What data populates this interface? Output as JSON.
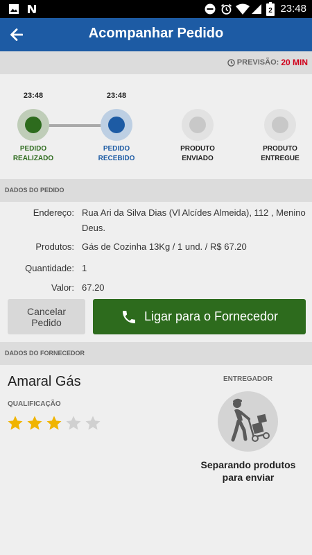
{
  "status_bar": {
    "time": "23:48",
    "battery": "2",
    "left_icons": [
      "image-icon",
      "n-icon"
    ],
    "right_icons": [
      "dnd-icon",
      "alarm-icon",
      "wifi-icon",
      "signal-icon",
      "battery-icon"
    ]
  },
  "app_bar": {
    "title": "Acompanhar Pedido",
    "back_icon": "back-arrow-icon"
  },
  "eta": {
    "label": "PREVISÃO:",
    "value": "20 MIN",
    "icon": "clock-icon"
  },
  "timeline": {
    "steps": [
      {
        "time": "23:48",
        "line1": "PEDIDO",
        "line2": "REALIZADO",
        "state": "done",
        "color": "#2d6b1d",
        "ring": "#bfcdb8"
      },
      {
        "time": "23:48",
        "line1": "PEDIDO",
        "line2": "RECEBIDO",
        "state": "current",
        "color": "#1d5ba4",
        "ring": "#bdcfe3"
      },
      {
        "time": "",
        "line1": "PRODUTO",
        "line2": "ENVIADO",
        "state": "pending",
        "color": "#c8c8c8",
        "ring": "#e2e2e2"
      },
      {
        "time": "",
        "line1": "PRODUTO",
        "line2": "ENTREGUE",
        "state": "pending",
        "color": "#c8c8c8",
        "ring": "#e2e2e2"
      }
    ]
  },
  "order": {
    "section_title": "DADOS DO PEDIDO",
    "address_label": "Endereço:",
    "address_value": "Rua Ari da Silva Dias (Vl Alcídes Almeida), 112  , Menino Deus.",
    "products_label": "Produtos:",
    "products_value": "Gás de Cozinha 13Kg / 1 und. / R$ 67.20",
    "quantity_label": "Quantidade:",
    "quantity_value": "1",
    "value_label": "Valor:",
    "value_value": "67.20"
  },
  "actions": {
    "cancel_line1": "Cancelar",
    "cancel_line2": "Pedido",
    "call_label": "Ligar para o Fornecedor",
    "call_icon": "phone-icon"
  },
  "supplier": {
    "section_title": "DADOS DO FORNECEDOR",
    "name": "Amaral Gás",
    "rating_label": "QUALIFICAÇÃO",
    "rating": 3,
    "rating_max": 5,
    "star_color": "#f0b400",
    "deliverer_label": "ENTREGADOR",
    "deliverer_icon": "delivery-person-icon",
    "status_line1": "Separando produtos",
    "status_line2": "para enviar"
  },
  "colors": {
    "primary": "#1d5ba4",
    "accent_green": "#2d6b1d",
    "eta_red": "#d0001b"
  }
}
